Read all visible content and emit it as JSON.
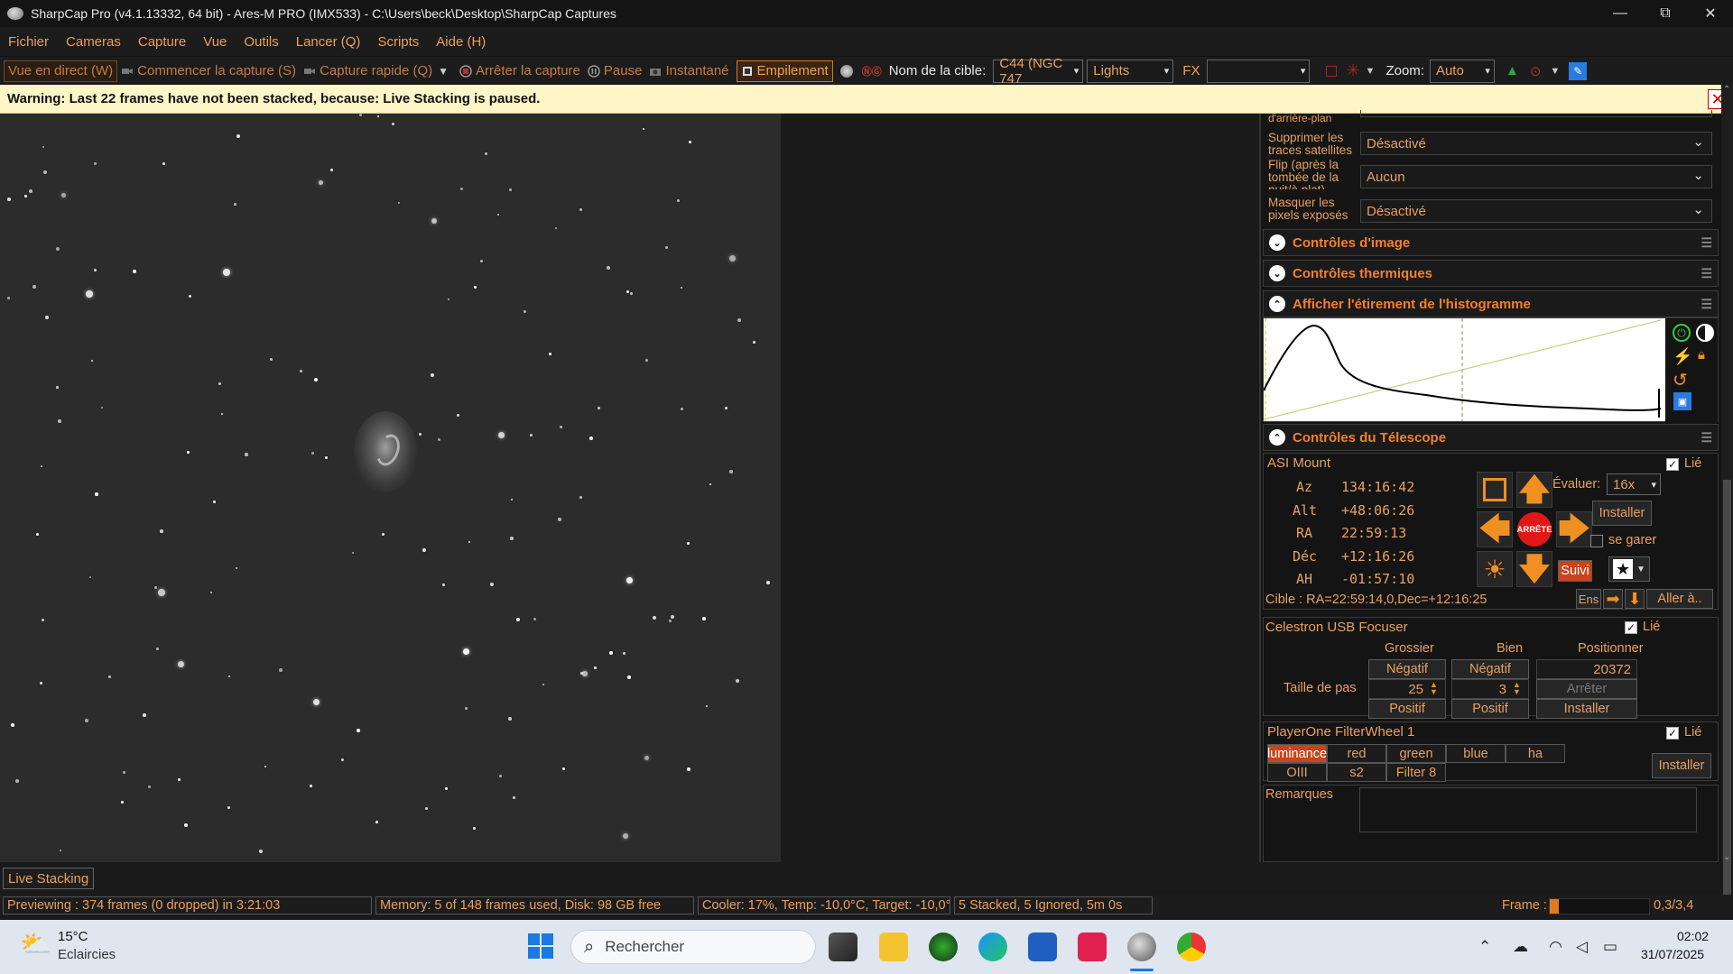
{
  "titlebar": {
    "title": "SharpCap Pro (v4.1.13332, 64 bit) - Ares-M PRO (IMX533) - C:\\Users\\beck\\Desktop\\SharpCap Captures",
    "minimize": "—",
    "maximize": "⧉",
    "close": "✕"
  },
  "menu": [
    "Fichier",
    "Cameras",
    "Capture",
    "Vue",
    "Outils",
    "Lancer (Q)",
    "Scripts",
    "Aide (H)"
  ],
  "toolbar": {
    "live_view": "Vue en direct (W)",
    "start_capture": "Commencer la capture (S)",
    "quick_capture": "Capture rapide (Q)",
    "stop_capture": "Arrêter la capture",
    "pause": "Pause",
    "snapshot": "Instantané",
    "stacking": "Empilement",
    "target_label": "Nom de la cible:",
    "target_value": "C44 (NGC 747",
    "frame_type": "Lights",
    "fx_label": "FX",
    "fx_value": "",
    "zoom_label": "Zoom:",
    "zoom_value": "Auto"
  },
  "warning": {
    "text": "Warning: Last 22 frames have not been stacked, because: Live Stacking is paused.",
    "close": "✕"
  },
  "settings": {
    "partial_label": "d'arrière-plan",
    "rows": [
      {
        "label": "Supprimer les traces satellites",
        "value": "Désactivé"
      },
      {
        "label": "Flip (après la tombée de la nuit/à plat)",
        "value": "Aucun"
      },
      {
        "label": "Masquer les pixels exposés",
        "value": "Désactivé"
      }
    ]
  },
  "sections": {
    "image_controls": "Contrôles d'image",
    "thermal_controls": "Contrôles thermiques",
    "histogram": "Afficher l'étirement de l'histogramme",
    "telescope": "Contrôles du Télescope"
  },
  "mount": {
    "name": "ASI Mount",
    "linked_label": "Lié",
    "coords": [
      {
        "label": "Az",
        "value": "134:16:42"
      },
      {
        "label": "Alt",
        "value": "+48:06:26"
      },
      {
        "label": "RA",
        "value": "22:59:13"
      },
      {
        "label": "Déc",
        "value": "+12:16:26"
      },
      {
        "label": "AH",
        "value": "-01:57:10"
      }
    ],
    "stop_label": "ARRÊTE",
    "rate_label": "Évaluer:",
    "rate_value": "16x",
    "install": "Installer",
    "park": "se garer",
    "track": "Suivi",
    "target": "Cible : RA=22:59:14,0,Dec=+12:16:25",
    "ens": "Ens",
    "goto": "Aller à.."
  },
  "focuser": {
    "name": "Celestron USB Focuser",
    "linked_label": "Lié",
    "col_coarse": "Grossier",
    "col_fine": "Bien",
    "col_position": "Positionner",
    "negative": "Négatif",
    "positive": "Positif",
    "position_value": "20372",
    "step_label": "Taille de pas",
    "coarse_step": "25",
    "fine_step": "3",
    "stop": "Arrêter",
    "install": "Installer"
  },
  "filterwheel": {
    "name": "PlayerOne FilterWheel 1",
    "linked_label": "Lié",
    "filters_row1": [
      "luminance",
      "red",
      "green",
      "blue",
      "ha"
    ],
    "filters_row2": [
      "OIII",
      "s2",
      "Filter 8"
    ],
    "selected": "luminance",
    "install": "Installer"
  },
  "notes": {
    "label": "Remarques"
  },
  "livestack_tab": "Live Stacking",
  "status": {
    "preview": "Previewing : 374 frames (0 dropped) in 3:21:03",
    "memory": "Memory: 5 of 148 frames used, Disk: 98 GB free",
    "cooler": "Cooler: 17%, Temp: -10,0°C, Target: -10,0°",
    "stacked": "5 Stacked, 5 Ignored, 5m 0s",
    "frame_label": "Frame :",
    "frame_value": "0,3/3,4",
    "frame_progress": 0.09
  },
  "taskbar": {
    "weather_temp": "15°C",
    "weather_desc": "Eclaircies",
    "search_placeholder": "Rechercher",
    "time": "02:02",
    "date": "31/07/2025"
  },
  "colors": {
    "accent_orange": "#e8a060",
    "warning_bg": "#fff6c8",
    "selected_filter": "#c8451c"
  }
}
